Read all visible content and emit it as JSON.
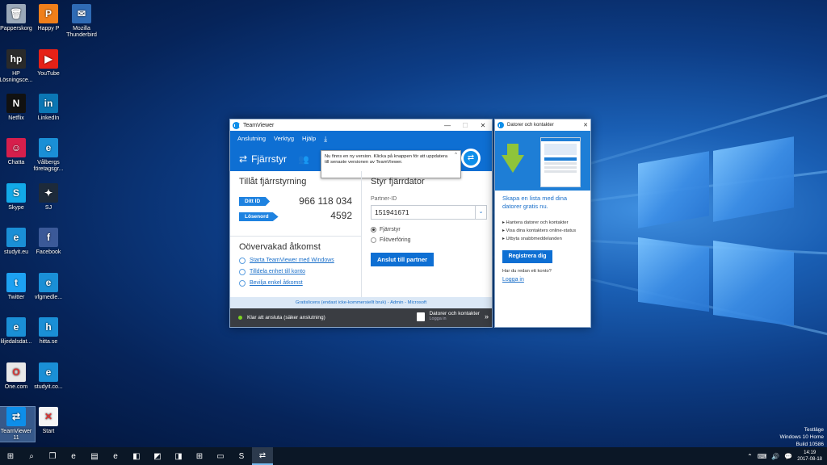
{
  "desktop_icons": [
    {
      "label": "Papperskorg",
      "glyph": "🗑",
      "color": "#9aa8b8"
    },
    {
      "label": "Happy P",
      "glyph": "P",
      "color": "#f07f1a"
    },
    {
      "label": "Mozilla Thunderbird",
      "glyph": "✉",
      "color": "#2f6bb5"
    },
    {
      "label": "HP Lösningsce...",
      "glyph": "hp",
      "color": "#2a2a2a"
    },
    {
      "label": "YouTube",
      "glyph": "▶",
      "color": "#e62117"
    },
    {
      "label": "Netflix",
      "glyph": "N",
      "color": "#111"
    },
    {
      "label": "LinkedIn",
      "glyph": "in",
      "color": "#0b76b4"
    },
    {
      "label": "Chatta",
      "glyph": "☺",
      "color": "#d61f4c"
    },
    {
      "label": "Vålbergs företagsgr...",
      "glyph": "e",
      "color": "#1a8fd6"
    },
    {
      "label": "Skype",
      "glyph": "S",
      "color": "#12a9e8"
    },
    {
      "label": "SJ",
      "glyph": "✦",
      "color": "#1d2a3a"
    },
    {
      "label": "studyit.eu",
      "glyph": "e",
      "color": "#1a8fd6"
    },
    {
      "label": "Facebook",
      "glyph": "f",
      "color": "#3b5998"
    },
    {
      "label": "Twitter",
      "glyph": "t",
      "color": "#1da1f2"
    },
    {
      "label": "vfgmedle...",
      "glyph": "e",
      "color": "#1a8fd6"
    },
    {
      "label": "liljedalsdat...",
      "glyph": "e",
      "color": "#1a8fd6"
    },
    {
      "label": "hitta.se",
      "glyph": "h",
      "color": "#1a8fd6"
    },
    {
      "label": "One.com",
      "glyph": "O",
      "color": "#e8e8e8"
    },
    {
      "label": "studyit.co...",
      "glyph": "e",
      "color": "#1a8fd6"
    },
    {
      "label": "TeamViewer 11",
      "glyph": "⇄",
      "color": "#0e8ee9"
    },
    {
      "label": "Start",
      "glyph": "✕",
      "color": "#f5f5f5"
    }
  ],
  "teamviewer": {
    "title": "TeamViewer",
    "menu": [
      "Anslutning",
      "Verktyg",
      "Hjälp"
    ],
    "tab_label": "Fjärrstyr",
    "update_tooltip": "Nu finns en ny version. Klicka på knappen för att uppdatera till senaste versionen av TeamViewer.",
    "allow_title": "Tillåt fjärrstyrning",
    "id_label": "Ditt ID",
    "id_value": "966 118 034",
    "pw_label": "Lösenord",
    "pw_value": "4592",
    "unattended_title": "Oövervakad åtkomst",
    "unattended_links": [
      "Starta TeamViewer med Windows",
      "Tilldela enhet till konto",
      "Bevilja enkel åtkomst"
    ],
    "control_title": "Styr fjärrdator",
    "partner_label": "Partner-ID",
    "partner_value": "151941671",
    "radio_remote": "Fjärrstyr",
    "radio_file": "Filöverföring",
    "connect_button": "Anslut till partner",
    "license_text": "Gratislicens (endast icke-kommersiellt bruk) - Admin - Microsoft",
    "status_text": "Klar att ansluta (säker anslutning)",
    "computers_title": "Datorer och kontakter",
    "computers_sub": "Logga in",
    "status_color": "#7ed321"
  },
  "contacts_panel": {
    "title": "Datorer och kontakter",
    "headline": "Skapa en lista med dina datorer gratis nu.",
    "bullets": [
      "Hantera datorer och kontakter",
      "Visa dina kontakters online-status",
      "Utbyta snabbmeddelanden"
    ],
    "register_button": "Registrera dig",
    "have_account": "Har du redan ett konto?",
    "login_link": "Logga in"
  },
  "taskbar": {
    "apps": [
      "⊞",
      "⌕",
      "❐",
      "e",
      "▤",
      "e",
      "◧",
      "◩",
      "◨",
      "⊞",
      "▭",
      "S",
      "⇄"
    ],
    "active_index": 12,
    "tray": [
      "⌃",
      "⌨",
      "🔊",
      "💬"
    ],
    "time": "14:19",
    "date": "2017-08-18"
  },
  "watermark": {
    "line1": "Testläge",
    "line2": "Windows 10 Home",
    "line3": "Build 10586"
  },
  "colors": {
    "accent": "#0e6fd3",
    "link": "#1a6fc9"
  }
}
